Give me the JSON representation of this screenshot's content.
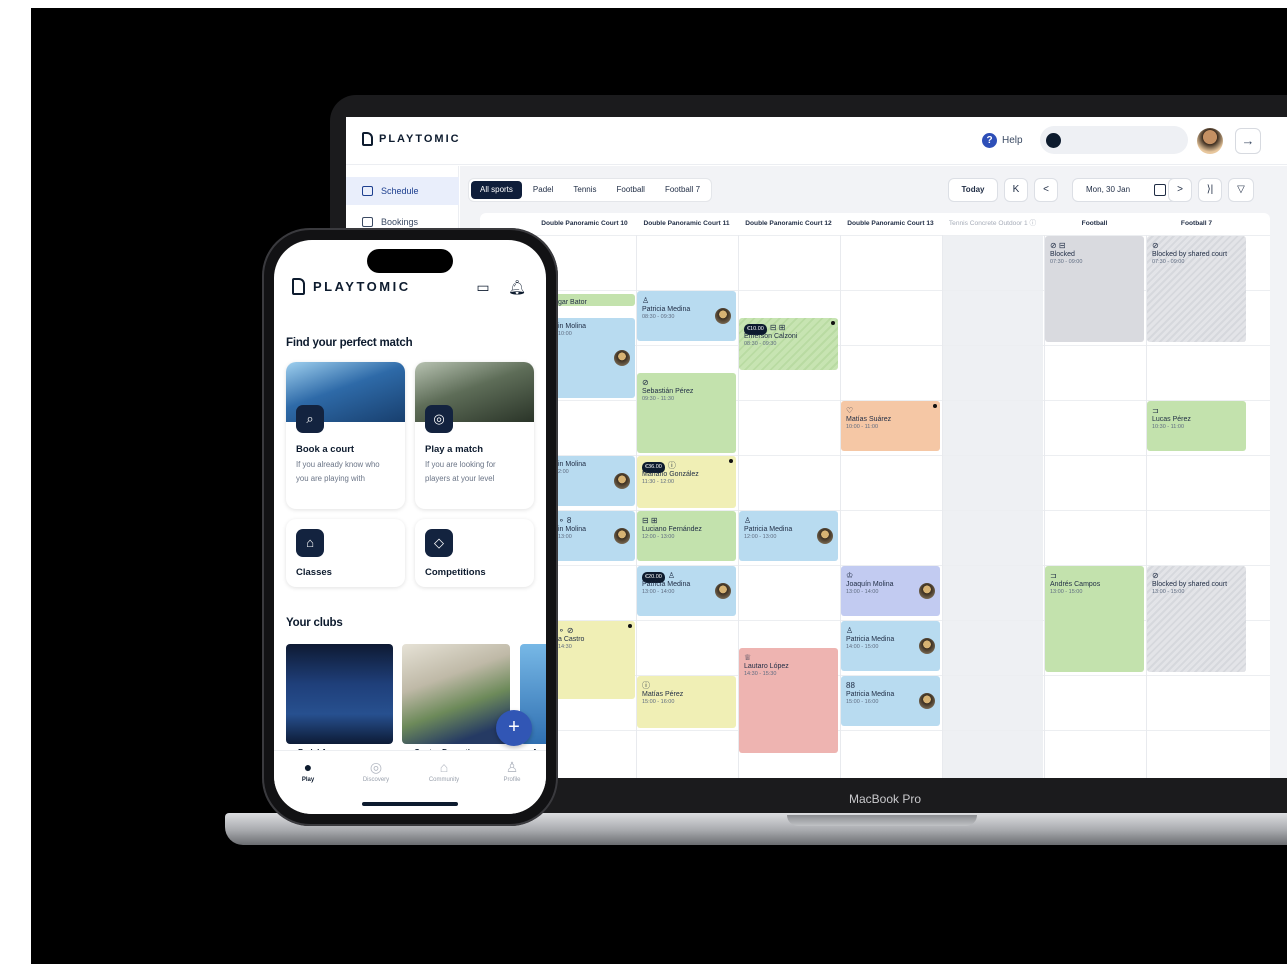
{
  "laptop": {
    "label": "MacBook Pro",
    "brand": "PLAYTOMIC",
    "help": "Help",
    "help_glyph": "?",
    "logout_glyph": "→",
    "sidebar": [
      {
        "label": "Schedule",
        "active": true
      },
      {
        "label": "Bookings",
        "active": false
      }
    ],
    "sport_tabs": [
      "All sports",
      "Padel",
      "Tennis",
      "Football",
      "Football 7"
    ],
    "nav": {
      "today": "Today",
      "first": "K",
      "prev": "<",
      "date": "Mon, 30 Jan",
      "next": ">",
      "last": "⟩|",
      "filter": "▽"
    },
    "columns": [
      {
        "name": "Double Panoramic Court 10",
        "muted": false
      },
      {
        "name": "Double Panoramic Court 11",
        "muted": false
      },
      {
        "name": "Double Panoramic Court 12",
        "muted": false
      },
      {
        "name": "Double Panoramic Court 13",
        "muted": false
      },
      {
        "name": "Tennis Concrete Outdoor 1 ⓘ",
        "muted": true
      },
      {
        "name": "Football",
        "muted": false
      },
      {
        "name": "Football 7",
        "muted": false
      }
    ],
    "events": [
      {
        "col": 0,
        "name": "gar Bator",
        "time": "",
        "icon": "",
        "price": "",
        "color": "green",
        "avatar": false,
        "dot": false
      },
      {
        "col": 0,
        "name": "in Molina",
        "time": "10:00",
        "icon": "",
        "price": "",
        "color": "blue",
        "avatar": true,
        "dot": false
      },
      {
        "col": 0,
        "name": "in Molina",
        "time": "2:00",
        "icon": "",
        "price": "",
        "color": "blue",
        "avatar": true,
        "dot": false
      },
      {
        "col": 0,
        "name": "in Molina",
        "time": "13:00",
        "icon": "⚬ 8",
        "price": "",
        "color": "blue",
        "avatar": true,
        "dot": false
      },
      {
        "col": 0,
        "name": "a Castro",
        "time": "14:30",
        "icon": "⚬ ⊘",
        "price": "",
        "color": "yellow",
        "avatar": false,
        "dot": true
      },
      {
        "col": 1,
        "name": "Patricia Medina",
        "time": "08:30 - 09:30",
        "icon": "♙",
        "price": "",
        "color": "blue",
        "avatar": true,
        "dot": false
      },
      {
        "col": 1,
        "name": "Sebastián Pérez",
        "time": "09:30 - 11:30",
        "icon": "⊘",
        "price": "",
        "color": "green",
        "avatar": false,
        "dot": false
      },
      {
        "col": 1,
        "name": "Mariano González",
        "time": "11:30 - 12:00",
        "icon": "ⓘ",
        "price": "€36.00",
        "color": "yellow",
        "avatar": false,
        "dot": true
      },
      {
        "col": 1,
        "name": "Luciano Fernández",
        "time": "12:00 - 13:00",
        "icon": "⊟ ⊞",
        "price": "",
        "color": "green",
        "avatar": false,
        "dot": false
      },
      {
        "col": 1,
        "name": "Patricia Medina",
        "time": "13:00 - 14:00",
        "icon": "♙",
        "price": "€20.00",
        "color": "blue",
        "avatar": true,
        "dot": false
      },
      {
        "col": 1,
        "name": "Matías Pérez",
        "time": "15:00 - 16:00",
        "icon": "ⓘ",
        "price": "",
        "color": "yellow",
        "avatar": false,
        "dot": false
      },
      {
        "col": 2,
        "name": "Emerson Calzoni",
        "time": "08:30 - 09:30",
        "icon": "⊟ ⊞",
        "price": "€10.00",
        "color": "green-hatch",
        "avatar": false,
        "dot": true
      },
      {
        "col": 2,
        "name": "Patricia Medina",
        "time": "12:00 - 13:00",
        "icon": "♙",
        "price": "",
        "color": "blue",
        "avatar": true,
        "dot": false
      },
      {
        "col": 2,
        "name": "Lautaro López",
        "time": "14:30 - 15:30",
        "icon": "♕",
        "price": "",
        "color": "red",
        "avatar": false,
        "dot": false
      },
      {
        "col": 3,
        "name": "Matías Suárez",
        "time": "10:00 - 11:00",
        "icon": "♡",
        "price": "",
        "color": "orange",
        "avatar": false,
        "dot": true
      },
      {
        "col": 3,
        "name": "Joaquín Molina",
        "time": "13:00 - 14:00",
        "icon": "♔",
        "price": "",
        "color": "violet",
        "avatar": true,
        "dot": false
      },
      {
        "col": 3,
        "name": "Patricia Medina",
        "time": "14:00 - 15:00",
        "icon": "♙",
        "price": "",
        "color": "blue",
        "avatar": true,
        "dot": false
      },
      {
        "col": 3,
        "name": "Patricia Medina",
        "time": "15:00 - 16:00",
        "icon": "88",
        "price": "",
        "color": "blue",
        "avatar": true,
        "dot": false
      },
      {
        "col": 5,
        "name": "Blocked",
        "time": "07:30 - 09:00",
        "icon": "⊘ ⊟",
        "price": "",
        "color": "grey",
        "avatar": false,
        "dot": false
      },
      {
        "col": 5,
        "name": "Andrés Campos",
        "time": "13:00 - 15:00",
        "icon": "⊐",
        "price": "",
        "color": "green",
        "avatar": false,
        "dot": false
      },
      {
        "col": 6,
        "name": "Blocked by shared court",
        "time": "07:30 - 09:00",
        "icon": "⊘",
        "price": "",
        "color": "hatch",
        "avatar": false,
        "dot": false
      },
      {
        "col": 6,
        "name": "Lucas Pérez",
        "time": "10:30 - 11:00",
        "icon": "⊐",
        "price": "",
        "color": "green",
        "avatar": false,
        "dot": false
      },
      {
        "col": 6,
        "name": "Blocked by shared court",
        "time": "13:00 - 15:00",
        "icon": "⊘",
        "price": "",
        "color": "hatch",
        "avatar": false,
        "dot": false
      }
    ]
  },
  "phone": {
    "brand": "PLAYTOMIC",
    "chat_glyph": "▭",
    "bell_glyph": "🔔︎",
    "find_heading": "Find your perfect match",
    "cards": [
      {
        "title": "Book a court",
        "subtitle": "If you already know who you are playing with",
        "icon": "search-icon",
        "glyph": "⌕"
      },
      {
        "title": "Play a match",
        "subtitle": "If you are looking for players at your level",
        "icon": "ball-icon",
        "glyph": "◎"
      },
      {
        "title": "Classes",
        "subtitle": "",
        "icon": "graduation-cap-icon",
        "glyph": "⌂"
      },
      {
        "title": "Competitions",
        "subtitle": "",
        "icon": "shield-icon",
        "glyph": "◇"
      }
    ],
    "clubs_heading": "Your clubs",
    "club_captions": [
      "Padel A",
      "Centro Deporti",
      "A"
    ],
    "fab_glyph": "+",
    "tabbar": [
      {
        "label": "Play",
        "glyph": "●",
        "active": true
      },
      {
        "label": "Discovery",
        "glyph": "◎",
        "active": false
      },
      {
        "label": "Community",
        "glyph": "⌂",
        "active": false
      },
      {
        "label": "Profile",
        "glyph": "♙",
        "active": false
      }
    ]
  }
}
